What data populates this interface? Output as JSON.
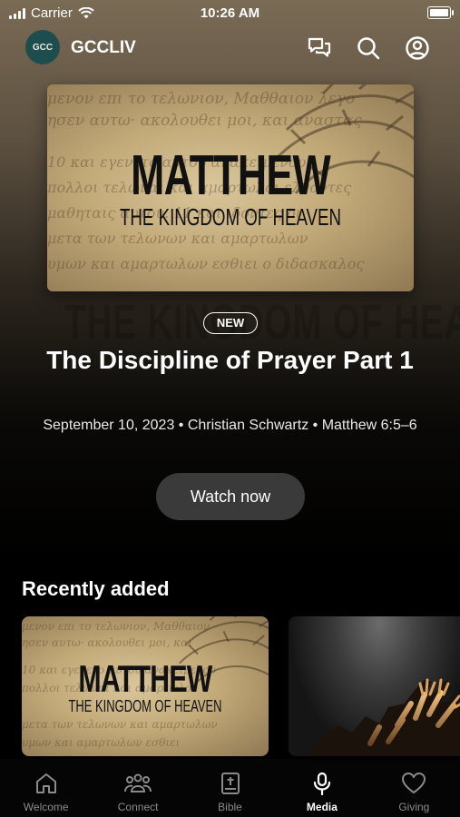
{
  "status_bar": {
    "carrier": "Carrier",
    "time": "10:26 AM"
  },
  "header": {
    "logo_text": "GCC",
    "brand": "GCCLIV"
  },
  "hero": {
    "artwork": {
      "title": "MATTHEW",
      "subtitle": "THE KINGDOM OF HEAVEN"
    },
    "ghost_text": "THE KINGDOM OF HEAVEN",
    "badge": "NEW",
    "title": "The Discipline of Prayer Part 1",
    "meta": "September 10, 2023 • Christian Schwartz • Matthew 6:5–6",
    "watch_label": "Watch now"
  },
  "recently_added": {
    "title": "Recently added",
    "cards": [
      {
        "title": "MATTHEW",
        "subtitle": "THE KINGDOM OF HEAVEN"
      },
      {
        "title": ""
      }
    ]
  },
  "tabs": [
    {
      "label": "Welcome",
      "icon": "home-icon",
      "active": false
    },
    {
      "label": "Connect",
      "icon": "people-icon",
      "active": false
    },
    {
      "label": "Bible",
      "icon": "bible-icon",
      "active": false
    },
    {
      "label": "Media",
      "icon": "microphone-icon",
      "active": true
    },
    {
      "label": "Giving",
      "icon": "heart-icon",
      "active": false
    }
  ]
}
